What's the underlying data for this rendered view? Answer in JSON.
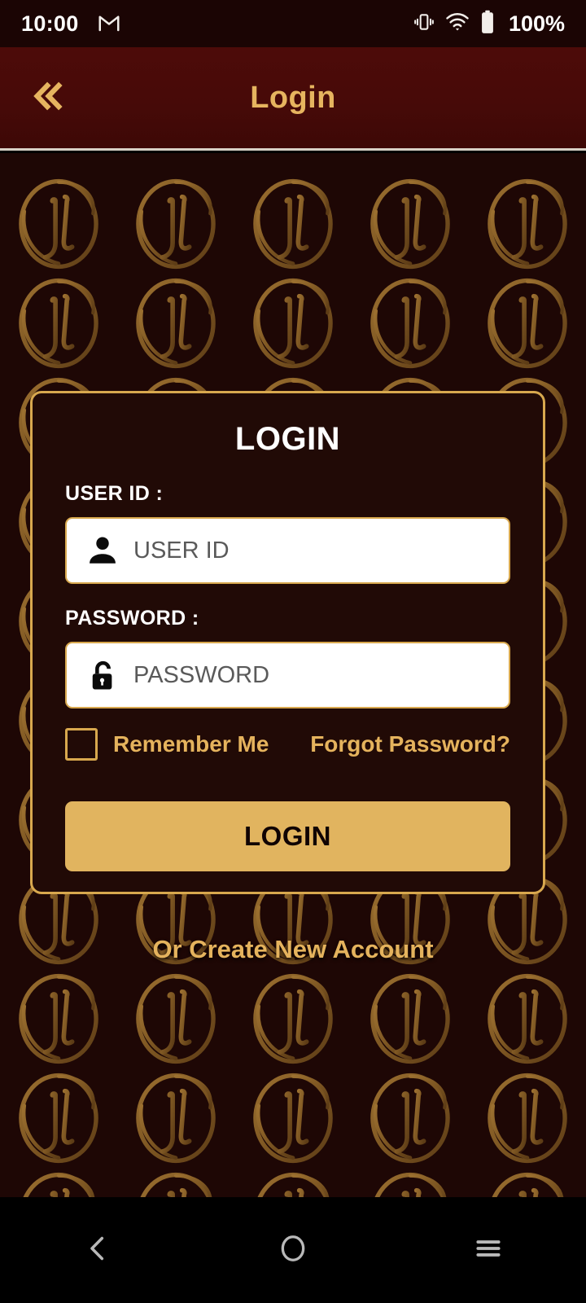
{
  "status_bar": {
    "time": "10:00",
    "notification_icon": "gmail-icon",
    "vibrate_icon": "vibrate-icon",
    "wifi_icon": "wifi-icon",
    "battery_icon": "battery-full-icon",
    "battery_percent": "100%"
  },
  "app_bar": {
    "back_icon": "double-chevron-left-icon",
    "title": "Login",
    "background_color": "#4a0a08",
    "title_color": "#e6b45f"
  },
  "background": {
    "color": "#1e0705",
    "watermark_icon": "jl-monogram-circle-icon",
    "watermark_color": "#8a6227",
    "columns": 5,
    "rows": 11
  },
  "card": {
    "title": "LOGIN",
    "border_color": "#d8a84e",
    "background_color": "#210a06",
    "user_id": {
      "label": "USER ID :",
      "placeholder": "USER ID",
      "value": "",
      "icon": "person-icon"
    },
    "password": {
      "label": "PASSWORD :",
      "placeholder": "PASSWORD",
      "value": "",
      "icon": "unlocked-padlock-icon"
    },
    "remember_me": {
      "label": "Remember Me",
      "checked": false
    },
    "forgot_password": "Forgot Password?",
    "submit_label": "LOGIN",
    "submit_color": "#e1b45f"
  },
  "create_account": "Or Create New Account",
  "nav_bar": {
    "back_icon": "chevron-left-icon",
    "home_icon": "circle-icon",
    "recents_icon": "hamburger-icon"
  }
}
